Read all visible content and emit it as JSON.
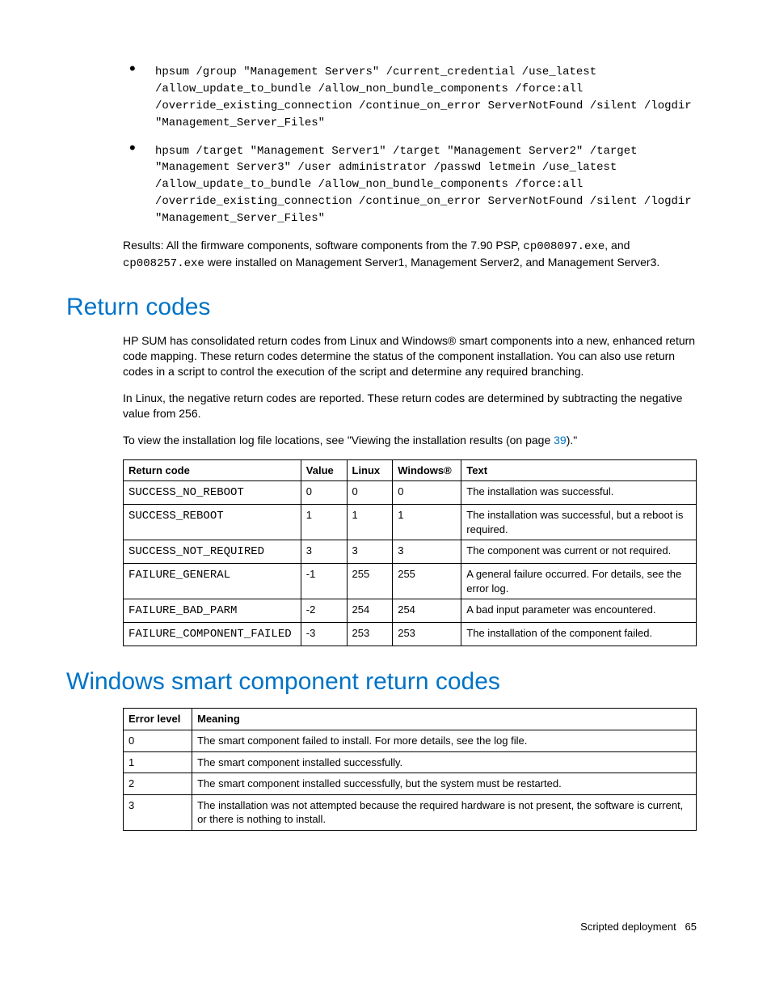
{
  "bullets": [
    "hpsum /group \"Management Servers\" /current_credential /use_latest /allow_update_to_bundle /allow_non_bundle_components /force:all /override_existing_connection /continue_on_error ServerNotFound /silent /logdir \"Management_Server_Files\"",
    "hpsum /target \"Management Server1\" /target \"Management Server2\" /target \"Management Server3\" /user administrator /passwd letmein /use_latest /allow_update_to_bundle /allow_non_bundle_components /force:all /override_existing_connection /continue_on_error ServerNotFound /silent /logdir \"Management_Server_Files\""
  ],
  "results": {
    "pre1": "Results: All the firmware components, software components from the 7.90 PSP, ",
    "code1": "cp008097.exe",
    "mid1": ", and ",
    "code2": "cp008257.exe",
    "post1": " were installed on Management Server1, Management Server2, and Management Server3."
  },
  "section1": {
    "heading": "Return codes",
    "p1": "HP SUM has consolidated return codes from Linux and Windows® smart components into a new, enhanced return code mapping. These return codes determine the status of the component installation. You can also use return codes in a script to control the execution of the script and determine any required branching.",
    "p2": "In Linux, the negative return codes are reported. These return codes are determined by subtracting the negative value from 256.",
    "p3_pre": "To view the installation log file locations, see \"Viewing the installation results (on page ",
    "p3_link": "39",
    "p3_post": ").\""
  },
  "table1": {
    "headers": [
      "Return code",
      "Value",
      "Linux",
      "Windows®",
      "Text"
    ],
    "rows": [
      {
        "code": "SUCCESS_NO_REBOOT",
        "value": "0",
        "linux": "0",
        "windows": "0",
        "text": "The installation was successful."
      },
      {
        "code": "SUCCESS_REBOOT",
        "value": "1",
        "linux": "1",
        "windows": "1",
        "text": "The installation was successful, but a reboot is required."
      },
      {
        "code": "SUCCESS_NOT_REQUIRED",
        "value": "3",
        "linux": "3",
        "windows": "3",
        "text": "The component was current or not required."
      },
      {
        "code": "FAILURE_GENERAL",
        "value": "-1",
        "linux": "255",
        "windows": "255",
        "text": "A general failure occurred. For details, see the error log."
      },
      {
        "code": "FAILURE_BAD_PARM",
        "value": "-2",
        "linux": "254",
        "windows": "254",
        "text": "A bad input parameter was encountered."
      },
      {
        "code": "FAILURE_COMPONENT_FAILED",
        "value": "-3",
        "linux": "253",
        "windows": "253",
        "text": "The installation of the component failed."
      }
    ]
  },
  "section2": {
    "heading": "Windows smart component return codes"
  },
  "table2": {
    "headers": [
      "Error level",
      "Meaning"
    ],
    "rows": [
      {
        "level": "0",
        "meaning": "The smart component failed to install. For more details, see the log file."
      },
      {
        "level": "1",
        "meaning": "The smart component installed successfully."
      },
      {
        "level": "2",
        "meaning": "The smart component installed successfully, but the system must be restarted."
      },
      {
        "level": "3",
        "meaning": "The installation was not attempted because the required hardware is not present, the software is current, or there is nothing to install."
      }
    ]
  },
  "footer": {
    "section": "Scripted deployment",
    "page": "65"
  }
}
